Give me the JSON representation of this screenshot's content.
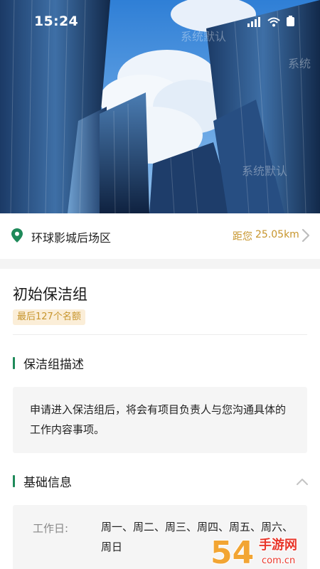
{
  "status_bar": {
    "time": "15:24"
  },
  "watermarks": [
    "系统",
    "系统默认",
    "系统默认"
  ],
  "location": {
    "name": "环球影城后场区",
    "distance_label": "距您",
    "distance_value": "25.05km"
  },
  "group": {
    "title": "初始保洁组",
    "quota_badge": "最后127个名额"
  },
  "description_section": {
    "heading": "保洁组描述",
    "text": "申请进入保洁组后，将会有项目负责人与您沟通具体的工作内容事项。"
  },
  "info_section": {
    "heading": "基础信息",
    "rows": [
      {
        "label": "工作日:",
        "value": "周一、周二、周三、周四、周五、周六、周日"
      }
    ]
  },
  "corner_logo": {
    "primary": "54",
    "secondary": "手游网",
    "domain": "com.cn"
  },
  "colors": {
    "accent_green": "#1f8a5a",
    "accent_gold": "#c7952c",
    "badge_bg": "#fbeed8"
  }
}
